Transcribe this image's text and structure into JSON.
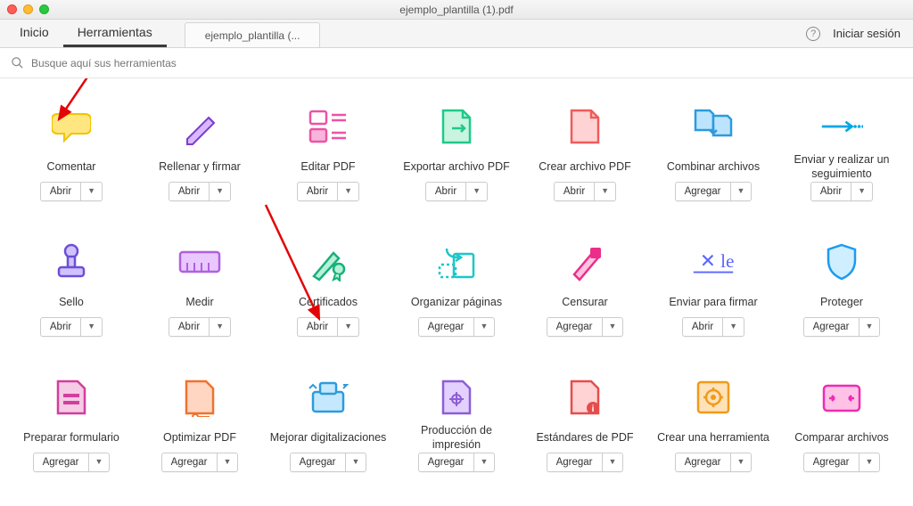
{
  "window": {
    "title": "ejemplo_plantilla (1).pdf"
  },
  "tabs": {
    "home": "Inicio",
    "tools": "Herramientas",
    "doc": "ejemplo_plantilla (..."
  },
  "header": {
    "login": "Iniciar sesión",
    "search_placeholder": "Busque aquí sus herramientas"
  },
  "btn": {
    "open": "Abrir",
    "add": "Agregar",
    "caret": "▼"
  },
  "tools": [
    {
      "label": "Comentar",
      "action": "open"
    },
    {
      "label": "Rellenar y firmar",
      "action": "open"
    },
    {
      "label": "Editar PDF",
      "action": "open"
    },
    {
      "label": "Exportar archivo PDF",
      "action": "open"
    },
    {
      "label": "Crear archivo PDF",
      "action": "open"
    },
    {
      "label": "Combinar archivos",
      "action": "add"
    },
    {
      "label": "Enviar y realizar un seguimiento",
      "action": "open"
    },
    {
      "label": "Sello",
      "action": "open"
    },
    {
      "label": "Medir",
      "action": "open"
    },
    {
      "label": "Certificados",
      "action": "open"
    },
    {
      "label": "Organizar páginas",
      "action": "add"
    },
    {
      "label": "Censurar",
      "action": "add"
    },
    {
      "label": "Enviar para firmar",
      "action": "open"
    },
    {
      "label": "Proteger",
      "action": "add"
    },
    {
      "label": "Preparar formulario",
      "action": "add"
    },
    {
      "label": "Optimizar PDF",
      "action": "add"
    },
    {
      "label": "Mejorar digitalizaciones",
      "action": "add"
    },
    {
      "label": "Producción de impresión",
      "action": "add"
    },
    {
      "label": "Estándares de PDF",
      "action": "add"
    },
    {
      "label": "Crear una herramienta",
      "action": "add"
    },
    {
      "label": "Comparar archivos",
      "action": "add"
    }
  ]
}
